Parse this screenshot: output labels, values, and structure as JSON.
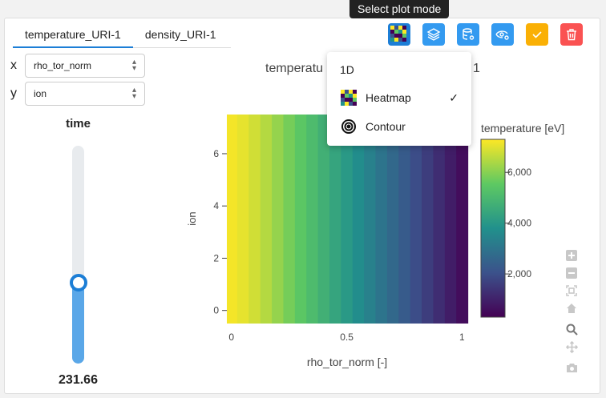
{
  "tooltip": "Select plot mode",
  "tabs": [
    {
      "label": "temperature_URI-1"
    },
    {
      "label": "density_URI-1"
    }
  ],
  "toolbar": {
    "buttons": [
      {
        "name": "plot-mode",
        "icon": "heatmap-icon",
        "color": "#1c7ed6"
      },
      {
        "name": "layers",
        "icon": "layers-icon",
        "color": "#1c7ed6"
      },
      {
        "name": "database",
        "icon": "database-gear-icon",
        "color": "#1c7ed6"
      },
      {
        "name": "visibility",
        "icon": "eye-gear-icon",
        "color": "#1c7ed6"
      },
      {
        "name": "confirm",
        "icon": "check-icon",
        "color": "#fab005"
      },
      {
        "name": "delete",
        "icon": "trash-icon",
        "color": "#fa5252"
      }
    ]
  },
  "axes_select": {
    "x_label": "x",
    "x_value": "rho_tor_norm",
    "y_label": "y",
    "y_value": "ion"
  },
  "time": {
    "title": "time",
    "value": "231.66",
    "slider_fraction": 0.37
  },
  "menu": {
    "items": [
      {
        "label": "1D"
      },
      {
        "label": "Heatmap",
        "selected": true
      },
      {
        "label": "Contour"
      }
    ]
  },
  "plot": {
    "title_left": "temperatu",
    "title_right": "1"
  },
  "chart_data": {
    "type": "heatmap",
    "title": "temperature_URI-1",
    "xlabel": "rho_tor_norm [-]",
    "ylabel": "ion",
    "x_ticks": [
      "0",
      "0.5",
      "1"
    ],
    "y_ticks": [
      "0",
      "2",
      "4",
      "6"
    ],
    "xlim": [
      -0.02,
      1.03
    ],
    "ylim": [
      -0.5,
      7.5
    ],
    "x": [
      0,
      0.05,
      0.1,
      0.15,
      0.2,
      0.25,
      0.3,
      0.35,
      0.4,
      0.45,
      0.5,
      0.55,
      0.6,
      0.65,
      0.7,
      0.75,
      0.8,
      0.85,
      0.9,
      0.95,
      1.0
    ],
    "values": [
      7200,
      7050,
      6800,
      6500,
      6150,
      5800,
      5450,
      5100,
      4750,
      4400,
      4050,
      3700,
      3350,
      3000,
      2650,
      2300,
      1950,
      1600,
      1250,
      900,
      550
    ],
    "colorbar": {
      "title": "temperature [eV]",
      "range": [
        300,
        7300
      ],
      "ticks": [
        "2,000",
        "4,000",
        "6,000"
      ],
      "tick_values": [
        2000,
        4000,
        6000
      ]
    }
  },
  "modebar": {
    "icons": [
      "zoom-in-icon",
      "zoom-out-icon",
      "autoscale-icon",
      "home-icon",
      "zoom-icon",
      "pan-icon",
      "camera-icon"
    ]
  }
}
